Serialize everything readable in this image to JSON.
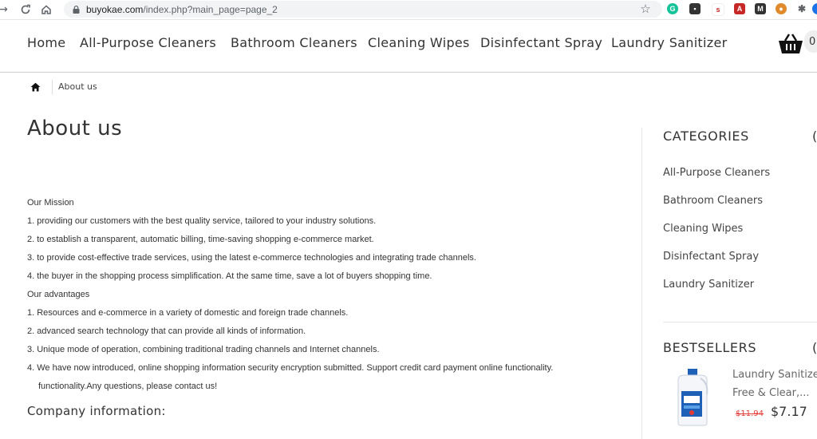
{
  "browser": {
    "url_domain": "buyokae.com",
    "url_path": "/index.php?main_page=page_2"
  },
  "nav": {
    "items": [
      "Home",
      "All-Purpose Cleaners",
      "Bathroom Cleaners",
      "Cleaning Wipes",
      "Disinfectant Spray",
      "Laundry Sanitizer"
    ],
    "cart_count": "0"
  },
  "breadcrumb": {
    "current": "About us"
  },
  "page": {
    "title": "About us",
    "paragraphs": [
      "Our Mission",
      "1. providing our customers with the best quality service, tailored to your industry solutions.",
      "2. to establish a transparent, automatic billing, time-saving shopping e-commerce market.",
      "3. to provide cost-effective trade services, using the latest e-commerce technologies and integrating trade channels.",
      "4. the buyer in the shopping process simplification. At the same time, save a lot of buyers shopping time.",
      "Our advantages",
      "1. Resources and e-commerce in a variety of domestic and foreign trade channels.",
      "2. advanced search technology that can provide all kinds of information.",
      "3. Unique mode of operation, combining traditional trading channels and Internet channels.",
      "4. We have now introduced, online shopping information security encryption submitted. Support credit card payment online functionality.",
      "functionality.Any questions, please contact us!"
    ],
    "company_heading": "Company information:"
  },
  "sidebar": {
    "categories_title": "CATEGORIES",
    "categories": [
      "All-Purpose Cleaners",
      "Bathroom Cleaners",
      "Cleaning Wipes",
      "Disinfectant Spray",
      "Laundry Sanitizer"
    ],
    "bestsellers_title": "BESTSELLERS",
    "product": {
      "name_line1": "Laundry Sanitize",
      "name_line2": "Free & Clear,...",
      "old_price": "$11.94",
      "new_price": "$7.17"
    }
  },
  "colors": {
    "accent_red": "#e53935",
    "text": "#333333"
  }
}
